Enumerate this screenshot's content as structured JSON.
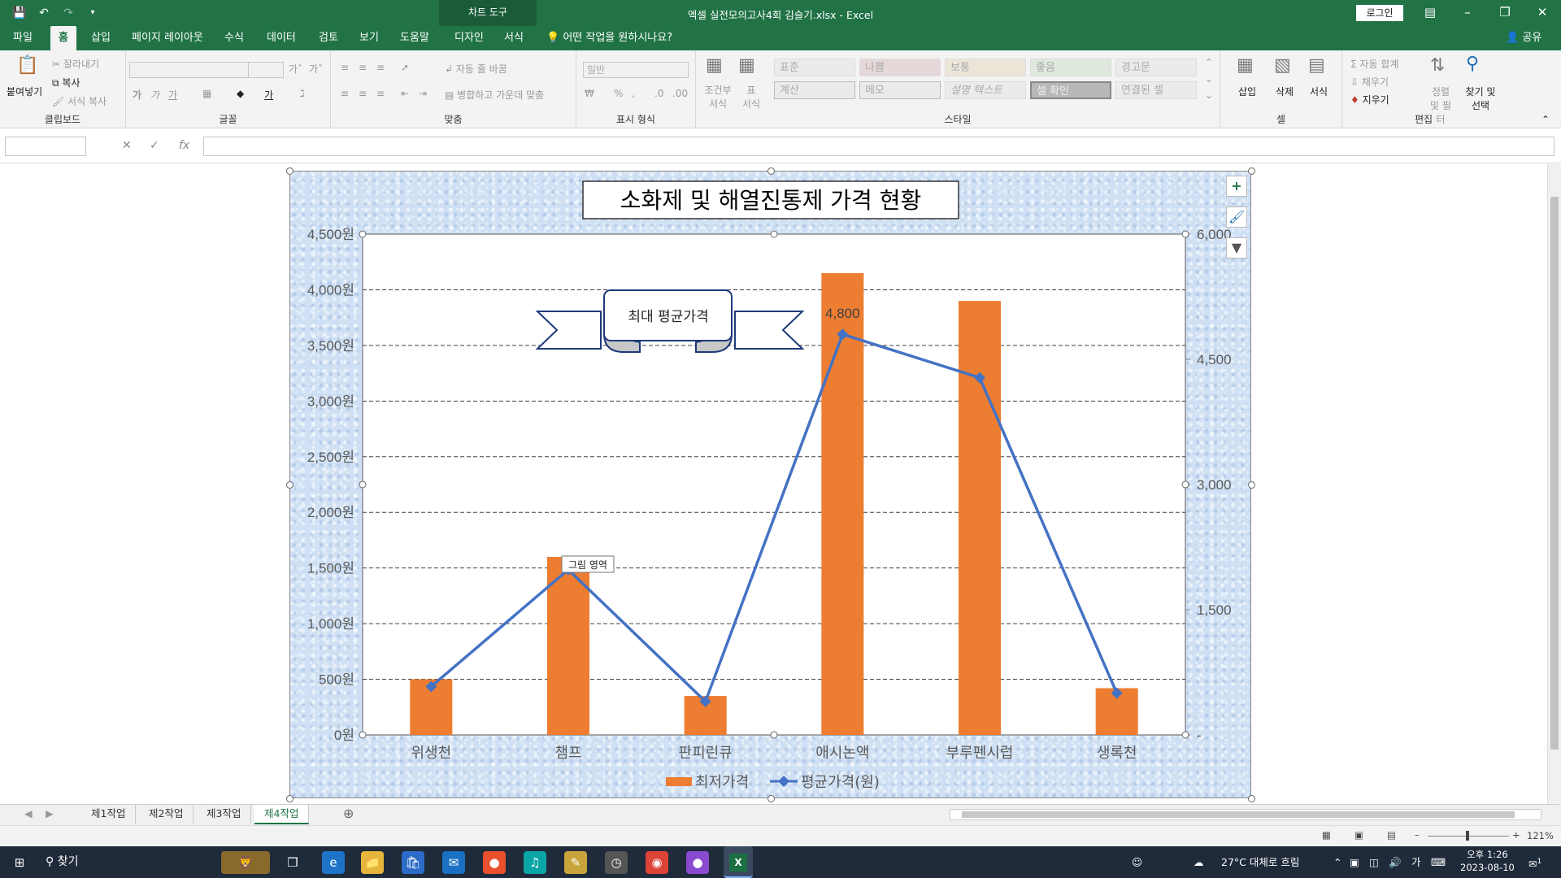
{
  "window": {
    "title": "엑셀 실전모의고사4회 김슬기.xlsx  -  Excel",
    "context_tab": "차트 도구",
    "login": "로그인"
  },
  "tabs": [
    {
      "label": "파일"
    },
    {
      "label": "홈"
    },
    {
      "label": "삽입"
    },
    {
      "label": "페이지 레이아웃"
    },
    {
      "label": "수식"
    },
    {
      "label": "데이터"
    },
    {
      "label": "검토"
    },
    {
      "label": "보기"
    },
    {
      "label": "도움말"
    },
    {
      "label": "디자인"
    },
    {
      "label": "서식"
    }
  ],
  "tell_me": "어떤 작업을 원하시나요?",
  "share": "공유",
  "ribbon": {
    "clipboard": {
      "paste": "붙여넣기",
      "cut": "잘라내기",
      "copy": "복사",
      "format_painter": "서식 복사",
      "label": "클립보드"
    },
    "font": {
      "label": "글꼴"
    },
    "alignment": {
      "wrap": "자동 줄 바꿈",
      "merge": "병합하고 가운데 맞춤",
      "label": "맞춤"
    },
    "number": {
      "format": "일반",
      "label": "표시 형식"
    },
    "styles": {
      "conditional": "조건부 서식",
      "table": "표 서식",
      "cells": [
        "표준",
        "나쁨",
        "보통",
        "좋음",
        "경고문",
        "계산",
        "메모",
        "설명 텍스트",
        "셀 확인",
        "연결된 셀"
      ],
      "label": "스타일"
    },
    "cells": {
      "insert": "삽입",
      "delete": "삭제",
      "format": "서식",
      "label": "셀"
    },
    "editing": {
      "autosum": "자동 합계",
      "fill": "채우기",
      "clear": "지우기",
      "sort": "정렬 및 필터",
      "find": "찾기 및 선택",
      "label": "편집"
    }
  },
  "formula_bar": {
    "fx": "fx"
  },
  "chart_data": {
    "type": "bar",
    "title": "소화제 및 해열진통제 가격 현황",
    "categories": [
      "위생천",
      "챔프",
      "판피린큐",
      "애시논액",
      "부루펜시럽",
      "생록천"
    ],
    "series": [
      {
        "name": "최저가격",
        "type": "bar",
        "axis": "primary",
        "color": "#ed7d31",
        "values": [
          500,
          1600,
          350,
          4150,
          3900,
          420
        ]
      },
      {
        "name": "평균가격(원)",
        "type": "line",
        "axis": "secondary",
        "color": "#4472c4",
        "values": [
          580,
          1980,
          400,
          4800,
          4280,
          500
        ]
      }
    ],
    "y_primary": {
      "min": 0,
      "max": 4500,
      "ticks": [
        "0원",
        "500원",
        "1,000원",
        "1,500원",
        "2,000원",
        "2,500원",
        "3,000원",
        "3,500원",
        "4,000원",
        "4,500원"
      ]
    },
    "y_secondary": {
      "min": 0,
      "max": 6000,
      "ticks": [
        "-",
        "1,500",
        "3,000",
        "4,500",
        "6,000"
      ]
    },
    "data_label": "4,800",
    "callout": "최대 평균가격",
    "tooltip": "그림 영역",
    "legend_position": "bottom",
    "grid": "dashed"
  },
  "sheet_tabs": [
    "제1작업",
    "제2작업",
    "제3작업",
    "제4작업"
  ],
  "active_sheet": "제4작업",
  "status": {
    "zoom": "121%"
  },
  "taskbar": {
    "search": "찾기",
    "weather": "27°C 대체로 흐림",
    "ime": "가",
    "time": "오후 1:26",
    "date": "2023-08-10",
    "notifications": "1"
  }
}
